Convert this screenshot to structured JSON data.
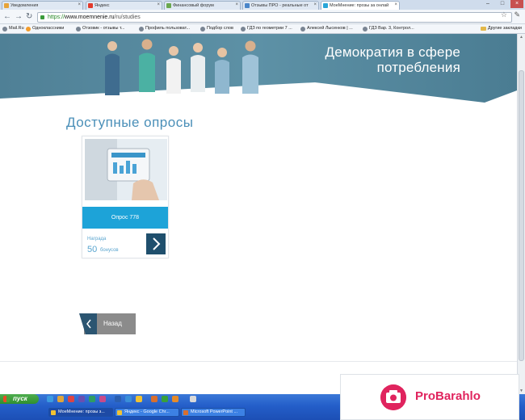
{
  "browser": {
    "tabs": [
      {
        "label": "Уведомления",
        "favicon_color": "#e7a43a",
        "active": false
      },
      {
        "label": "Яндекс",
        "favicon_color": "#e33a2b",
        "active": false
      },
      {
        "label": "Финансовый форум",
        "favicon_color": "#6aa84f",
        "active": false
      },
      {
        "label": "Отзывы ПРО - реальные от",
        "favicon_color": "#4a86c9",
        "active": false
      },
      {
        "label": "МоеМнение: прозы за онлай",
        "favicon_color": "#2aa6d8",
        "active": true
      }
    ],
    "url_scheme": "https://",
    "url_domain": "www.moemnenie.ru",
    "url_path": "/ru/studies",
    "bookmarks": [
      "Mail.Ru",
      "Одноклассники",
      "Отзовик - отзывы т...",
      "Профиль пользоват...",
      "Подбор слов",
      "ГДЗ по геометрии 7 ...",
      "Алексей Лысенков | ...",
      "ГДЗ Вар. 3, Контрол..."
    ],
    "other_bookmarks": "Другие закладки"
  },
  "banner": {
    "title": "Демократия в сфере потребления"
  },
  "main": {
    "heading": "Доступные опросы",
    "survey": {
      "button_label": "Опрос 778",
      "reward_label": "Награда",
      "reward_amount": "50",
      "reward_unit": "бонусов"
    },
    "back_label": "Назад"
  },
  "taskbar": {
    "start_label": "пуск",
    "tasks": [
      "МоеМнение: прозы з...",
      "Яндекс - Google Chr...",
      "Microsoft PowerPoint ..."
    ]
  },
  "watermark": {
    "text": "ProBarahlo"
  }
}
